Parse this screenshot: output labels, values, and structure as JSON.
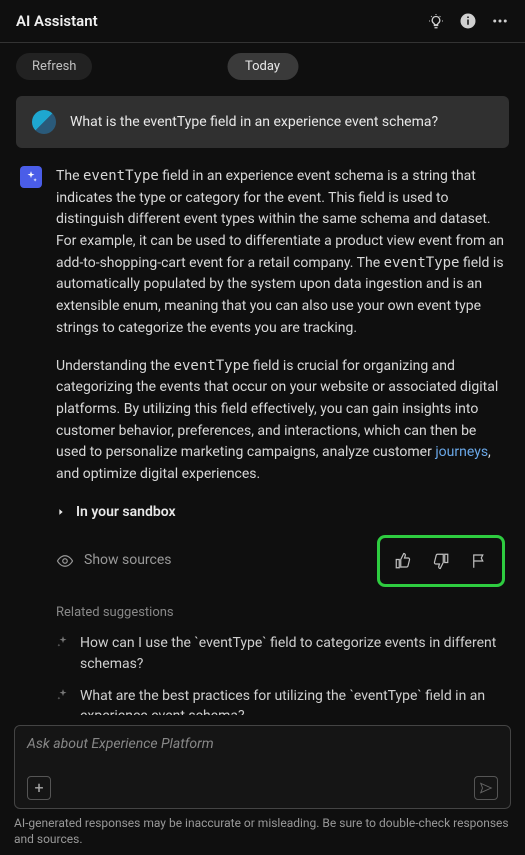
{
  "header": {
    "title": "AI Assistant"
  },
  "subheader": {
    "refresh_label": "Refresh",
    "today_label": "Today"
  },
  "user_message": {
    "text": "What is the eventType field in an experience event schema?"
  },
  "ai_message": {
    "p1_pre": "The ",
    "p1_code1": "eventType",
    "p1_mid": " field in an experience event schema is a string that indicates the type or category for the event. This field is used to distinguish different event types within the same schema and dataset. For example, it can be used to differentiate a product view event from an add-to-shopping-cart event for a retail company. The ",
    "p1_code2": "eventType",
    "p1_post": " field is automatically populated by the system upon data ingestion and is an extensible enum, meaning that you can also use your own event type strings to categorize the events you are tracking.",
    "p2_pre": "Understanding the ",
    "p2_code1": "eventType",
    "p2_mid": " field is crucial for organizing and categorizing the events that occur on your website or associated digital platforms. By utilizing this field effectively, you can gain insights into customer behavior, preferences, and interactions, which can then be used to personalize marketing campaigns, analyze customer ",
    "p2_link": "journeys",
    "p2_post": ", and optimize digital experiences."
  },
  "sandbox_label": "In your sandbox",
  "sources_label": "Show sources",
  "related": {
    "title": "Related suggestions",
    "items": [
      "How can I use the `eventType` field to categorize events in different schemas?",
      "What are the best practices for utilizing the `eventType` field in an experience event schema?"
    ]
  },
  "input": {
    "placeholder": "Ask about Experience Platform"
  },
  "disclaimer": "AI-generated responses may be inaccurate or misleading. Be sure to double-check responses and sources."
}
